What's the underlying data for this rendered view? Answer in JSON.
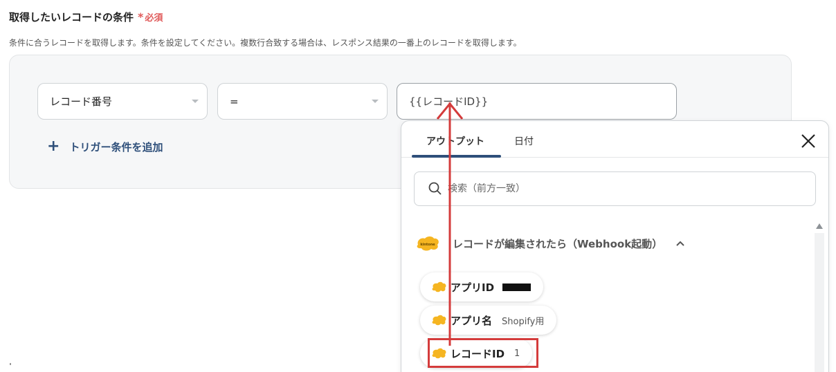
{
  "section": {
    "title": "取得したいレコードの条件",
    "required_mark": "*",
    "required_label": "必須",
    "description": "条件に合うレコードを取得します。条件を設定してください。複数行合致する場合は、レスポンス結果の一番上のレコードを取得します。"
  },
  "condition": {
    "field": "レコード番号",
    "operator": "=",
    "value": "{{レコードID}}"
  },
  "add_trigger_label": "トリガー条件を追加",
  "popover": {
    "tabs": [
      "アウトプット",
      "日付"
    ],
    "active_tab": "アウトプット",
    "search_placeholder": "検索（前方一致）",
    "group_title": "レコードが編集されたら（Webhook起動）",
    "logo_text": "kintone",
    "items": [
      {
        "name": "アプリID",
        "value": ""
      },
      {
        "name": "アプリ名",
        "value": "Shopify用"
      },
      {
        "name": "レコードID",
        "value": "1"
      }
    ]
  },
  "colors": {
    "accent": "#2e4f7a",
    "required": "#e05a5a",
    "annotation": "#d43b3b",
    "kintone": "#f5b521"
  },
  "icons": {
    "close": "close-icon",
    "search": "search-icon",
    "chevron": "chevron-up-icon",
    "plus": "plus-icon",
    "logo": "kintone-logo-icon"
  }
}
